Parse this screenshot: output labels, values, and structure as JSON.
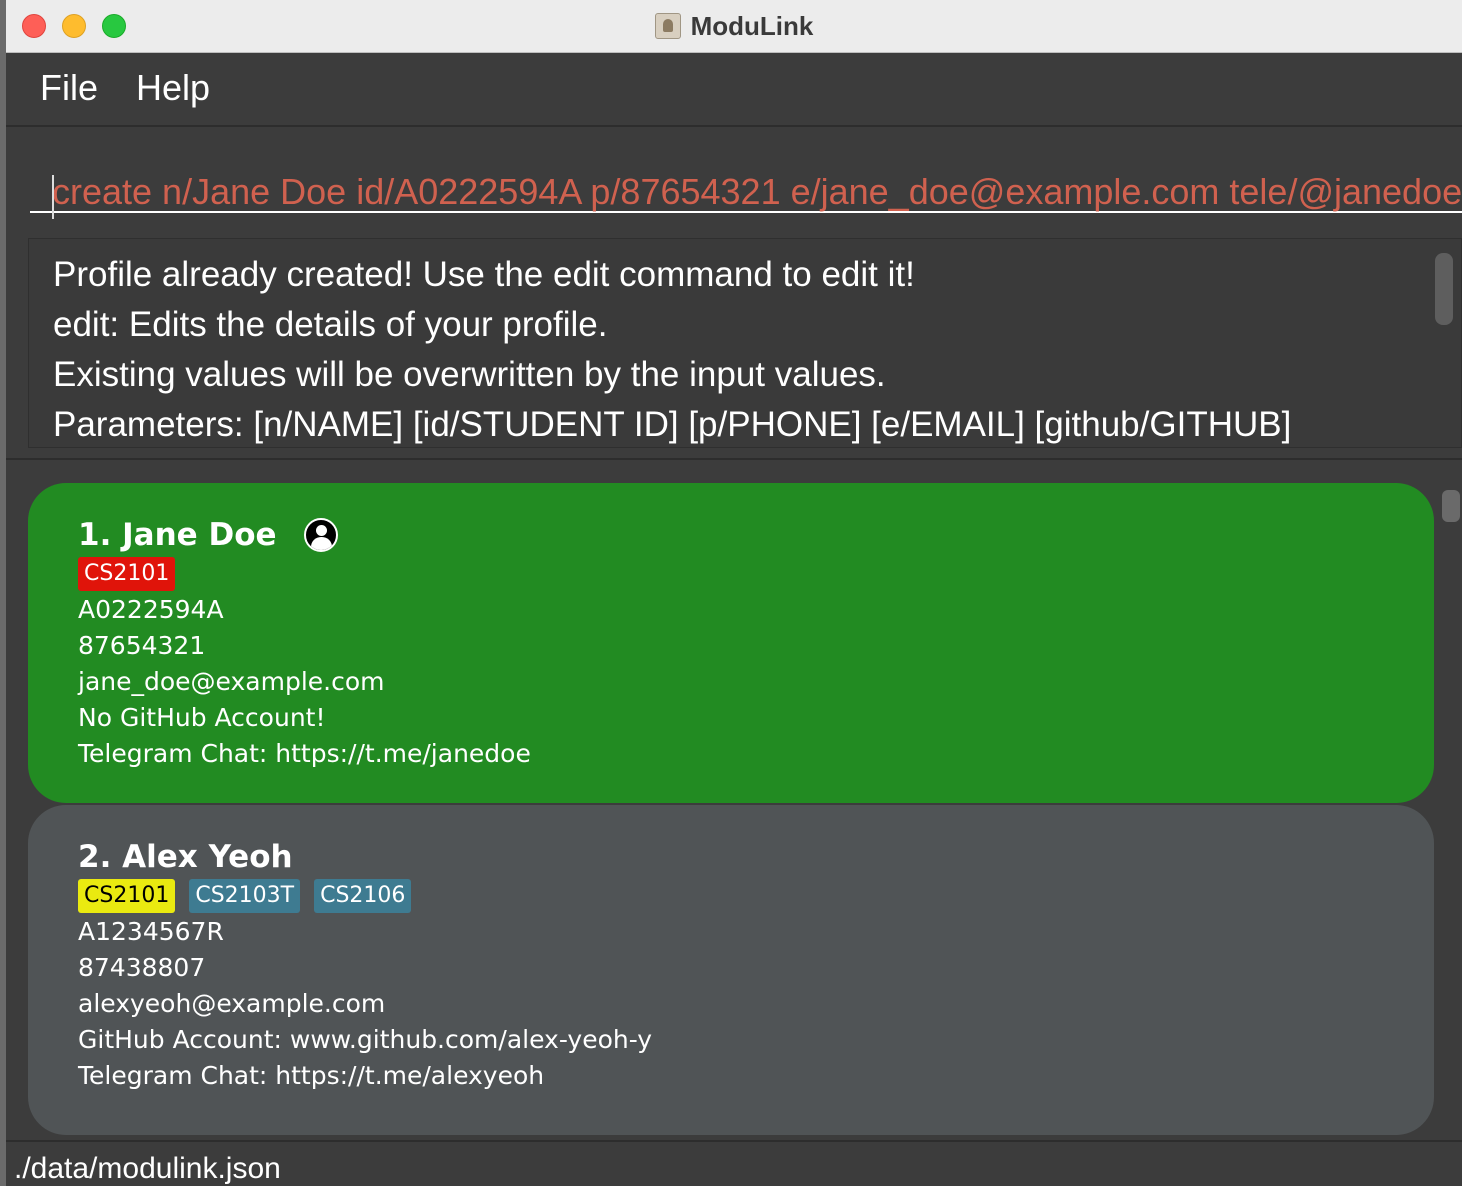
{
  "window": {
    "title": "ModuLink"
  },
  "menu": {
    "items": [
      "File",
      "Help"
    ]
  },
  "command": {
    "value": "create n/Jane Doe id/A0222594A p/87654321 e/jane_doe@example.com tele/@janedoe"
  },
  "result": {
    "lines": [
      "Profile already created! Use the edit command to edit it!",
      "edit: Edits the details of your profile.",
      "Existing values will be overwritten by the input values.",
      "Parameters: [n/NAME] [id/STUDENT ID] [p/PHONE] [e/EMAIL] [github/GITHUB]"
    ]
  },
  "persons": [
    {
      "name": "1. Jane Doe",
      "is_profile": true,
      "tags": [
        {
          "label": "CS2101",
          "color": "#e0140a"
        }
      ],
      "student_id": "A0222594A",
      "phone": "87654321",
      "email": "jane_doe@example.com",
      "github": "No GitHub Account!",
      "telegram": "Telegram Chat: https://t.me/janedoe",
      "card_color": "#228b22"
    },
    {
      "name": "2. Alex Yeoh",
      "is_profile": false,
      "tags": [
        {
          "label": "CS2101",
          "color": "#eaea10"
        },
        {
          "label": "CS2103T",
          "color": "#3e7b91"
        },
        {
          "label": "CS2106",
          "color": "#3e7b91"
        }
      ],
      "student_id": "A1234567R",
      "phone": "87438807",
      "email": "alexyeoh@example.com",
      "github": "GitHub Account: www.github.com/alex-yeoh-y",
      "telegram": "Telegram Chat: https://t.me/alexyeoh",
      "card_color": "#505456"
    }
  ],
  "status": {
    "file_path": "./data/modulink.json"
  }
}
